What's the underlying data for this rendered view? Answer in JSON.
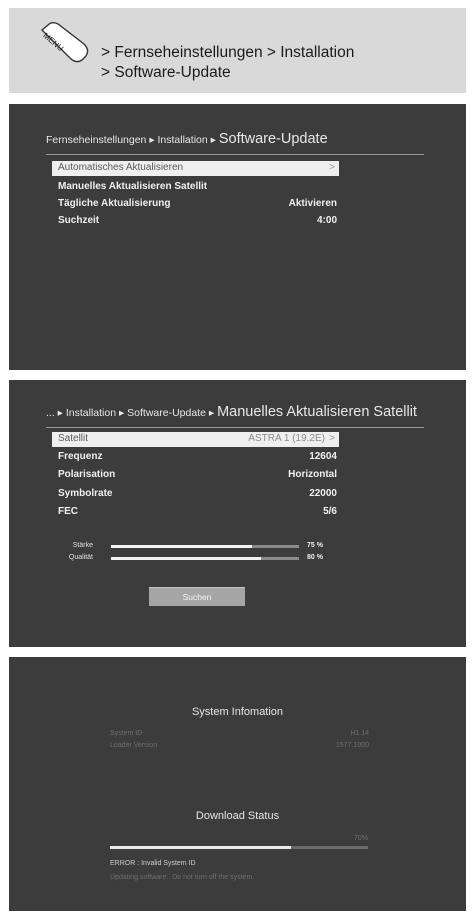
{
  "header": {
    "menu_key_label": "MENU",
    "path_line1": "> Fernseheinstellungen > Installation",
    "path_line2": "> Software-Update"
  },
  "screen1": {
    "breadcrumb_prefix": "Fernseheinstellungen ▸ Installation ▸",
    "breadcrumb_current": "Software-Update",
    "items": [
      {
        "label": "Automatisches Aktualisieren",
        "value": "",
        "arrow": ">"
      },
      {
        "label": "Manuelles Aktualisieren Satellit",
        "value": ""
      },
      {
        "label": "Tägliche Aktualisierung",
        "value": "Aktivieren"
      },
      {
        "label": "Suchzeit",
        "value": "4:00"
      }
    ]
  },
  "screen2": {
    "breadcrumb_prefix": "... ▸ Installation ▸ Software-Update ▸",
    "breadcrumb_current": "Manuelles Aktualisieren Satellit",
    "items": [
      {
        "label": "Satellit",
        "value": "ASTRA 1 (19.2E)",
        "arrow": ">"
      },
      {
        "label": "Frequenz",
        "value": "12604"
      },
      {
        "label": "Polarisation",
        "value": "Horizontal"
      },
      {
        "label": "Symbolrate",
        "value": "22000"
      },
      {
        "label": "FEC",
        "value": "5/6"
      }
    ],
    "strength_label": "Stärke",
    "strength_value": "75 %",
    "strength_level": 0.75,
    "quality_label": "Qualität",
    "quality_value": "80 %",
    "quality_level": 0.8,
    "search_button": "Suchen"
  },
  "screen3": {
    "system_title": "System Infomation",
    "system_id_label": "System ID",
    "system_id_value": "H1.14",
    "loader_label": "Loader Version",
    "loader_value": "1577.1000",
    "download_title": "Download Status",
    "download_pct": "70%",
    "download_level": 0.7,
    "error_text": "ERROR : Invalid System ID",
    "warning_text": "Updating software.. Do not turn off the system."
  }
}
